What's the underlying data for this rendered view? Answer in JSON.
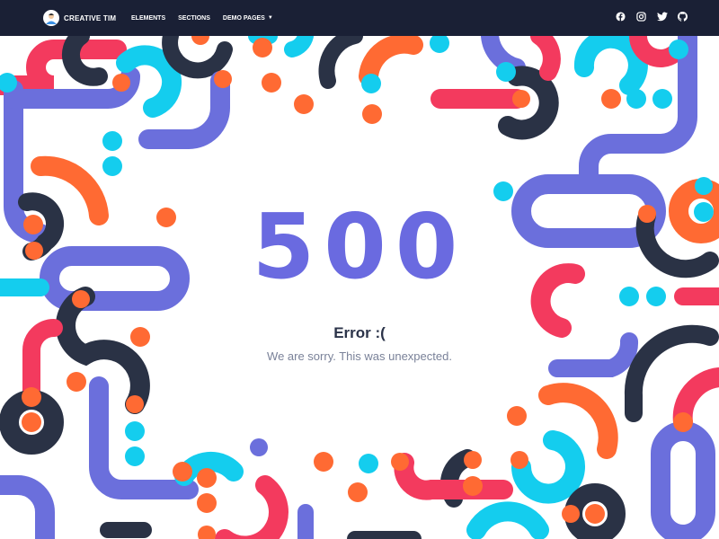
{
  "brand": {
    "name": "CREATIVE TIM"
  },
  "nav": {
    "items": [
      {
        "label": "ELEMENTS"
      },
      {
        "label": "SECTIONS"
      },
      {
        "label": "DEMO PAGES"
      }
    ]
  },
  "social": {
    "icons": [
      "facebook-icon",
      "instagram-icon",
      "twitter-icon",
      "github-icon"
    ]
  },
  "error": {
    "code": "500",
    "title": "Error :(",
    "message": "We are sorry. This was unexpected."
  },
  "colors": {
    "navbar": "#1a2035",
    "code": "#6a6ae0",
    "indigo": "#6b6fdc",
    "dark": "#2a3245",
    "cyan": "#14cdee",
    "orange": "#ff6a33",
    "pink": "#f33a5e"
  }
}
